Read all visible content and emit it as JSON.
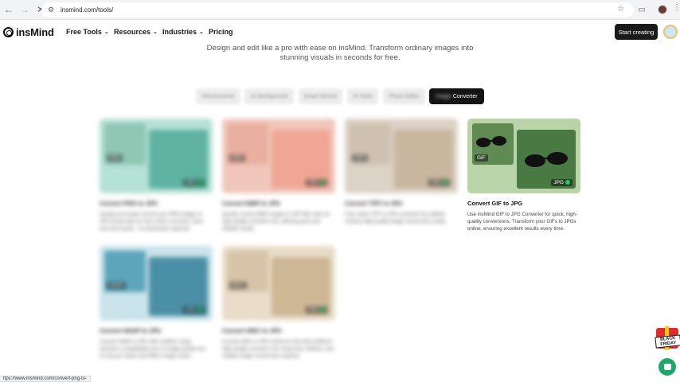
{
  "browser": {
    "url": "insmind.com/tools/",
    "status_url": "ttps://www.insmind.com/convert-png-to-"
  },
  "header": {
    "logo_text": "insMind",
    "nav": [
      {
        "label": "Free Tools",
        "has_menu": true
      },
      {
        "label": "Resources",
        "has_menu": true
      },
      {
        "label": "Industries",
        "has_menu": true
      },
      {
        "label": "Pricing",
        "has_menu": false
      }
    ],
    "cta_label": "Start creating"
  },
  "intro": {
    "text": "Design and edit like a pro with ease on insMind. Transform ordinary images into stunning visuals in seconds for free."
  },
  "tabs": [
    {
      "label": "Recommend",
      "active": false
    },
    {
      "label": "AI Background",
      "active": false
    },
    {
      "label": "Smart Resize",
      "active": false
    },
    {
      "label": "AI Tools",
      "active": false
    },
    {
      "label": "Photo Editor",
      "active": false
    },
    {
      "label_blurred": "Image",
      "label": "Converter",
      "active": true
    }
  ],
  "cards": [
    {
      "title": "Convert PNG to JPG",
      "desc": "Quickly and easily convert your PNG images to JPG format with our free online converter. Save time and hassle - no downloads required!",
      "in_tag": "PNG",
      "out_tag": "JPG",
      "blurred": true,
      "bg": "#b6e1d6",
      "photo_a": "#8fc6b4",
      "photo_b": "#5fb3a3"
    },
    {
      "title": "Convert BMP to JPG",
      "desc": "Quickly convert BMP images to JPG files with our high-quality converter tool, offering quick and reliable results.",
      "in_tag": "BMP",
      "out_tag": "JPG",
      "blurred": true,
      "bg": "#f1c7bb",
      "photo_a": "#e9b0a1",
      "photo_b": "#f0a695"
    },
    {
      "title": "Convert TIFF to JPG",
      "desc": "Free online TIFF to JPG converter by insMind. Achieve high-quality image conversions easily.",
      "in_tag": "TIFF",
      "out_tag": "JPG",
      "blurred": true,
      "bg": "#dcd2c6",
      "photo_a": "#cfc1b0",
      "photo_b": "#c8b69f"
    },
    {
      "title": "Convert GIF to JPG",
      "desc": "Use insMind GIF to JPG Converter for quick, high-quality conversions. Transform your GIFs to JPGs online, ensuring excellent results every time.",
      "in_tag": "GIF",
      "out_tag": "JPG",
      "blurred": false,
      "bg": "#b9d4a8",
      "photo_a": "#5f8a52",
      "photo_b": "#4a7a43"
    },
    {
      "title": "Convert WebP to JPG",
      "desc": "Convert WebP to JPG with insMind. Enjoy seamless compatibility and no image quality loss for all your online and offline image needs.",
      "in_tag": "WebP",
      "out_tag": "JPG",
      "blurred": true,
      "bg": "#c9e3ea",
      "photo_a": "#5da5bb",
      "photo_b": "#4b8fa6"
    },
    {
      "title": "Convert HEIC to JPG",
      "desc": "Convert HEIC to JPG online for free with insMind's high-quality converter tool. Enjoy fast, efficient, and reliable image conversions anytime.",
      "in_tag": "HEIC",
      "out_tag": "JPG",
      "blurred": true,
      "bg": "#e9ddca",
      "photo_a": "#d7c4a8",
      "photo_b": "#cdb795"
    }
  ],
  "floating": {
    "gift_label": "BLACK FRIDAY"
  }
}
